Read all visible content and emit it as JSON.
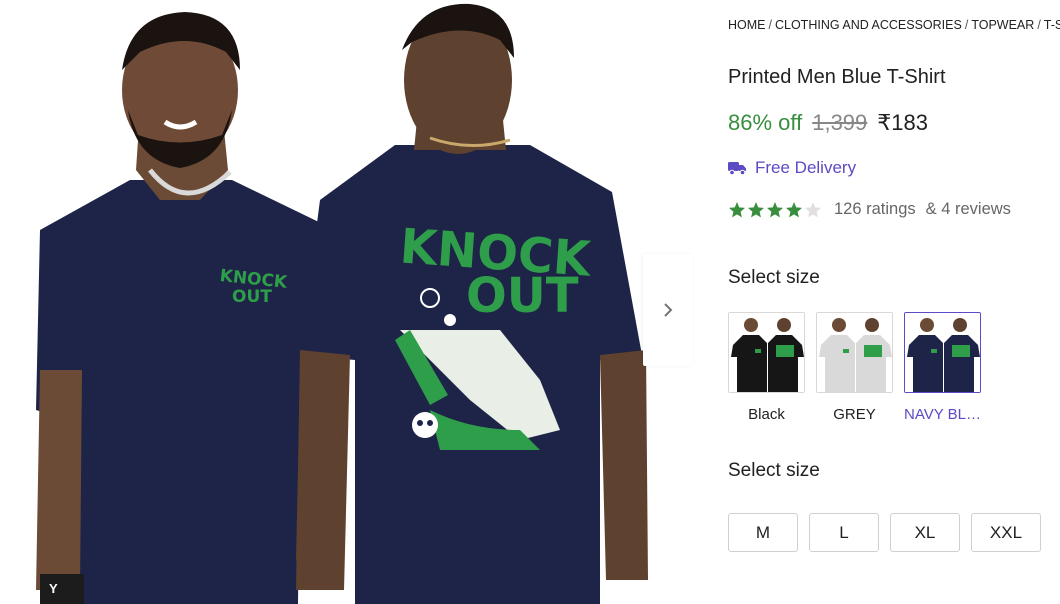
{
  "gallery": {
    "front_print_text": [
      "KNOCK",
      "OUT"
    ],
    "back_print_text": [
      "KNOCK",
      "OUT"
    ],
    "badge_label": "Y",
    "shirt_color": "#1d2447",
    "print_color": "#2f9e4a"
  },
  "breadcrumb": {
    "items": [
      "HOME",
      "CLOTHING AND ACCESSORIES",
      "TOPWEAR",
      "T-SHIRTS"
    ],
    "separator": "/"
  },
  "product": {
    "title": "Printed Men Blue T-Shirt",
    "discount": "86% off",
    "mrp": "1,399",
    "price": "₹183",
    "delivery": "Free Delivery",
    "rating_value": 4,
    "rating_max": 5,
    "ratings_count": "126 ratings",
    "reviews_count": "& 4 reviews"
  },
  "colors": {
    "label": "Select size",
    "selected_index": 2,
    "options": [
      {
        "name": "Black",
        "shirt": "#161616",
        "print": "#2f9e4a"
      },
      {
        "name": "GREY",
        "shirt": "#d9d9d9",
        "print": "#2f9e4a"
      },
      {
        "name": "NAVY BLUE",
        "shirt": "#1d2447",
        "print": "#2f9e4a"
      }
    ]
  },
  "sizes": {
    "label": "Select size",
    "options": [
      "M",
      "L",
      "XL",
      "XXL"
    ]
  },
  "theme": {
    "accent": "#5b4bc4",
    "discount_green": "#388e3c",
    "star_green": "#388e3c"
  }
}
